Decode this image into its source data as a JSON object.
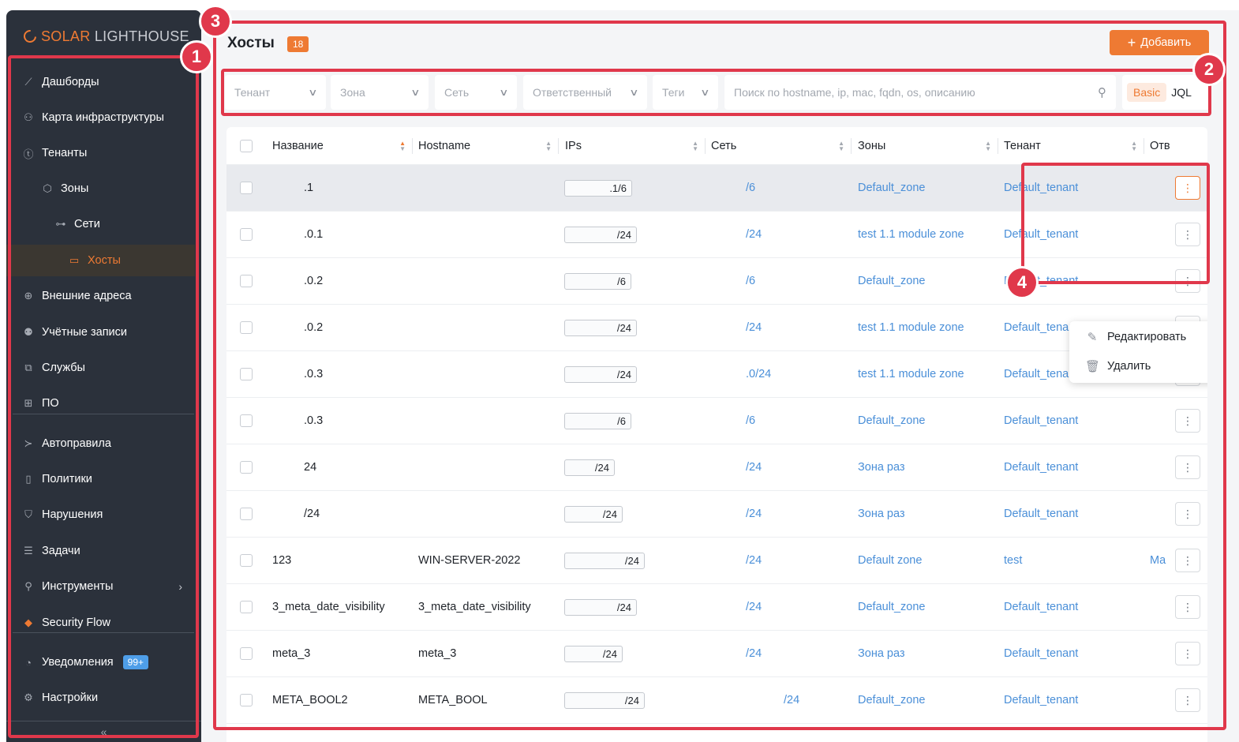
{
  "brand": {
    "solar": "SOLAR",
    "light": "LIGHTHOUSE"
  },
  "sidebar": {
    "items": [
      {
        "label": "Дашборды",
        "icon": "chart-icon",
        "glyph": "⟋"
      },
      {
        "label": "Карта инфраструктуры",
        "icon": "network-map-icon",
        "glyph": "⚇"
      },
      {
        "label": "Тенанты",
        "icon": "tenant-icon",
        "glyph": "ⓣ"
      },
      {
        "label": "Зоны",
        "icon": "cube-icon",
        "glyph": "⬡"
      },
      {
        "label": "Сети",
        "icon": "network-icon",
        "glyph": "⊶"
      },
      {
        "label": "Хосты",
        "icon": "monitor-icon",
        "glyph": "▭"
      },
      {
        "label": "Внешние адреса",
        "icon": "globe-icon",
        "glyph": "⊕"
      },
      {
        "label": "Учётные записи",
        "icon": "users-icon",
        "glyph": "⚉"
      },
      {
        "label": "Службы",
        "icon": "service-icon",
        "glyph": "⧉"
      },
      {
        "label": "ПО",
        "icon": "apps-icon",
        "glyph": "⊞"
      },
      {
        "label": "Автоправила",
        "icon": "terminal-icon",
        "glyph": "≻"
      },
      {
        "label": "Политики",
        "icon": "document-icon",
        "glyph": "▯"
      },
      {
        "label": "Нарушения",
        "icon": "shield-icon",
        "glyph": "⛉"
      },
      {
        "label": "Задачи",
        "icon": "list-icon",
        "glyph": "☰"
      },
      {
        "label": "Инструменты",
        "icon": "wrench-icon",
        "glyph": "⚲"
      },
      {
        "label": "Security Flow",
        "icon": "security-flow-icon",
        "glyph": "◆"
      },
      {
        "label": "Уведомления",
        "icon": "bell-icon",
        "glyph": "◔"
      },
      {
        "label": "Настройки",
        "icon": "gear-icon",
        "glyph": "⚙"
      }
    ],
    "notifications_badge": "99+",
    "collapse_glyph": "«"
  },
  "header": {
    "title": "Хосты",
    "count": "18",
    "add_label": "Добавить"
  },
  "filters": {
    "tenant": "Тенант",
    "zone": "Зона",
    "network": "Сеть",
    "owner": "Ответственный",
    "tags": "Теги",
    "search_placeholder": "Поиск по hostname, ip, mac, fqdn, os, описанию",
    "mode_basic": "Basic",
    "mode_jql": "JQL"
  },
  "table": {
    "columns": [
      "Название",
      "Hostname",
      "IPs",
      "Сеть",
      "Зоны",
      "Тенант",
      "Отв"
    ],
    "rows": [
      {
        "name": ".1",
        "hostname": "",
        "ip": ".1/6",
        "network": "/6",
        "zone": "Default_zone",
        "tenant": "Default_tenant",
        "owner": ""
      },
      {
        "name": ".0.1",
        "hostname": "",
        "ip": "/24",
        "network": "/24",
        "zone": "test 1.1 module zone",
        "tenant": "Default_tenant",
        "owner": ""
      },
      {
        "name": ".0.2",
        "hostname": "",
        "ip": "/6",
        "network": "/6",
        "zone": "Default_zone",
        "tenant": "Default_tenant",
        "owner": ""
      },
      {
        "name": ".0.2",
        "hostname": "",
        "ip": "/24",
        "network": "/24",
        "zone": "test 1.1 module zone",
        "tenant": "Default_tenant",
        "owner": ""
      },
      {
        "name": ".0.3",
        "hostname": "",
        "ip": "/24",
        "network": ".0/24",
        "zone": "test 1.1 module zone",
        "tenant": "Default_tenant",
        "owner": ""
      },
      {
        "name": ".0.3",
        "hostname": "",
        "ip": "/6",
        "network": "/6",
        "zone": "Default_zone",
        "tenant": "Default_tenant",
        "owner": ""
      },
      {
        "name": "24",
        "hostname": "",
        "ip": "/24",
        "network": "/24",
        "zone": "Зона раз",
        "tenant": "Default_tenant",
        "owner": ""
      },
      {
        "name": "/24",
        "hostname": "",
        "ip": "/24",
        "network": "/24",
        "zone": "Зона раз",
        "tenant": "Default_tenant",
        "owner": ""
      },
      {
        "name": "123",
        "hostname": "WIN-SERVER-2022",
        "ip": "/24",
        "network": "/24",
        "zone": "Default zone",
        "tenant": "test",
        "owner": "Ma"
      },
      {
        "name": "3_meta_date_visibility",
        "hostname": "3_meta_date_visibility",
        "ip": "/24",
        "network": "/24",
        "zone": "Default_zone",
        "tenant": "Default_tenant",
        "owner": ""
      },
      {
        "name": "meta_3",
        "hostname": "meta_3",
        "ip": "/24",
        "network": "/24",
        "zone": "Зона раз",
        "tenant": "Default_tenant",
        "owner": ""
      },
      {
        "name": "META_BOOL2",
        "hostname": "META_BOOL",
        "ip": "/24",
        "network": "/24",
        "zone": "Default_zone",
        "tenant": "Default_tenant",
        "owner": ""
      }
    ]
  },
  "menu": {
    "edit": "Редактировать",
    "delete": "Удалить"
  },
  "annotations": [
    "1",
    "2",
    "3",
    "4"
  ],
  "colors": {
    "accent": "#ee7a33",
    "link": "#4a8fd8",
    "annotation": "#e0384b",
    "sidebar": "#2b313b"
  }
}
